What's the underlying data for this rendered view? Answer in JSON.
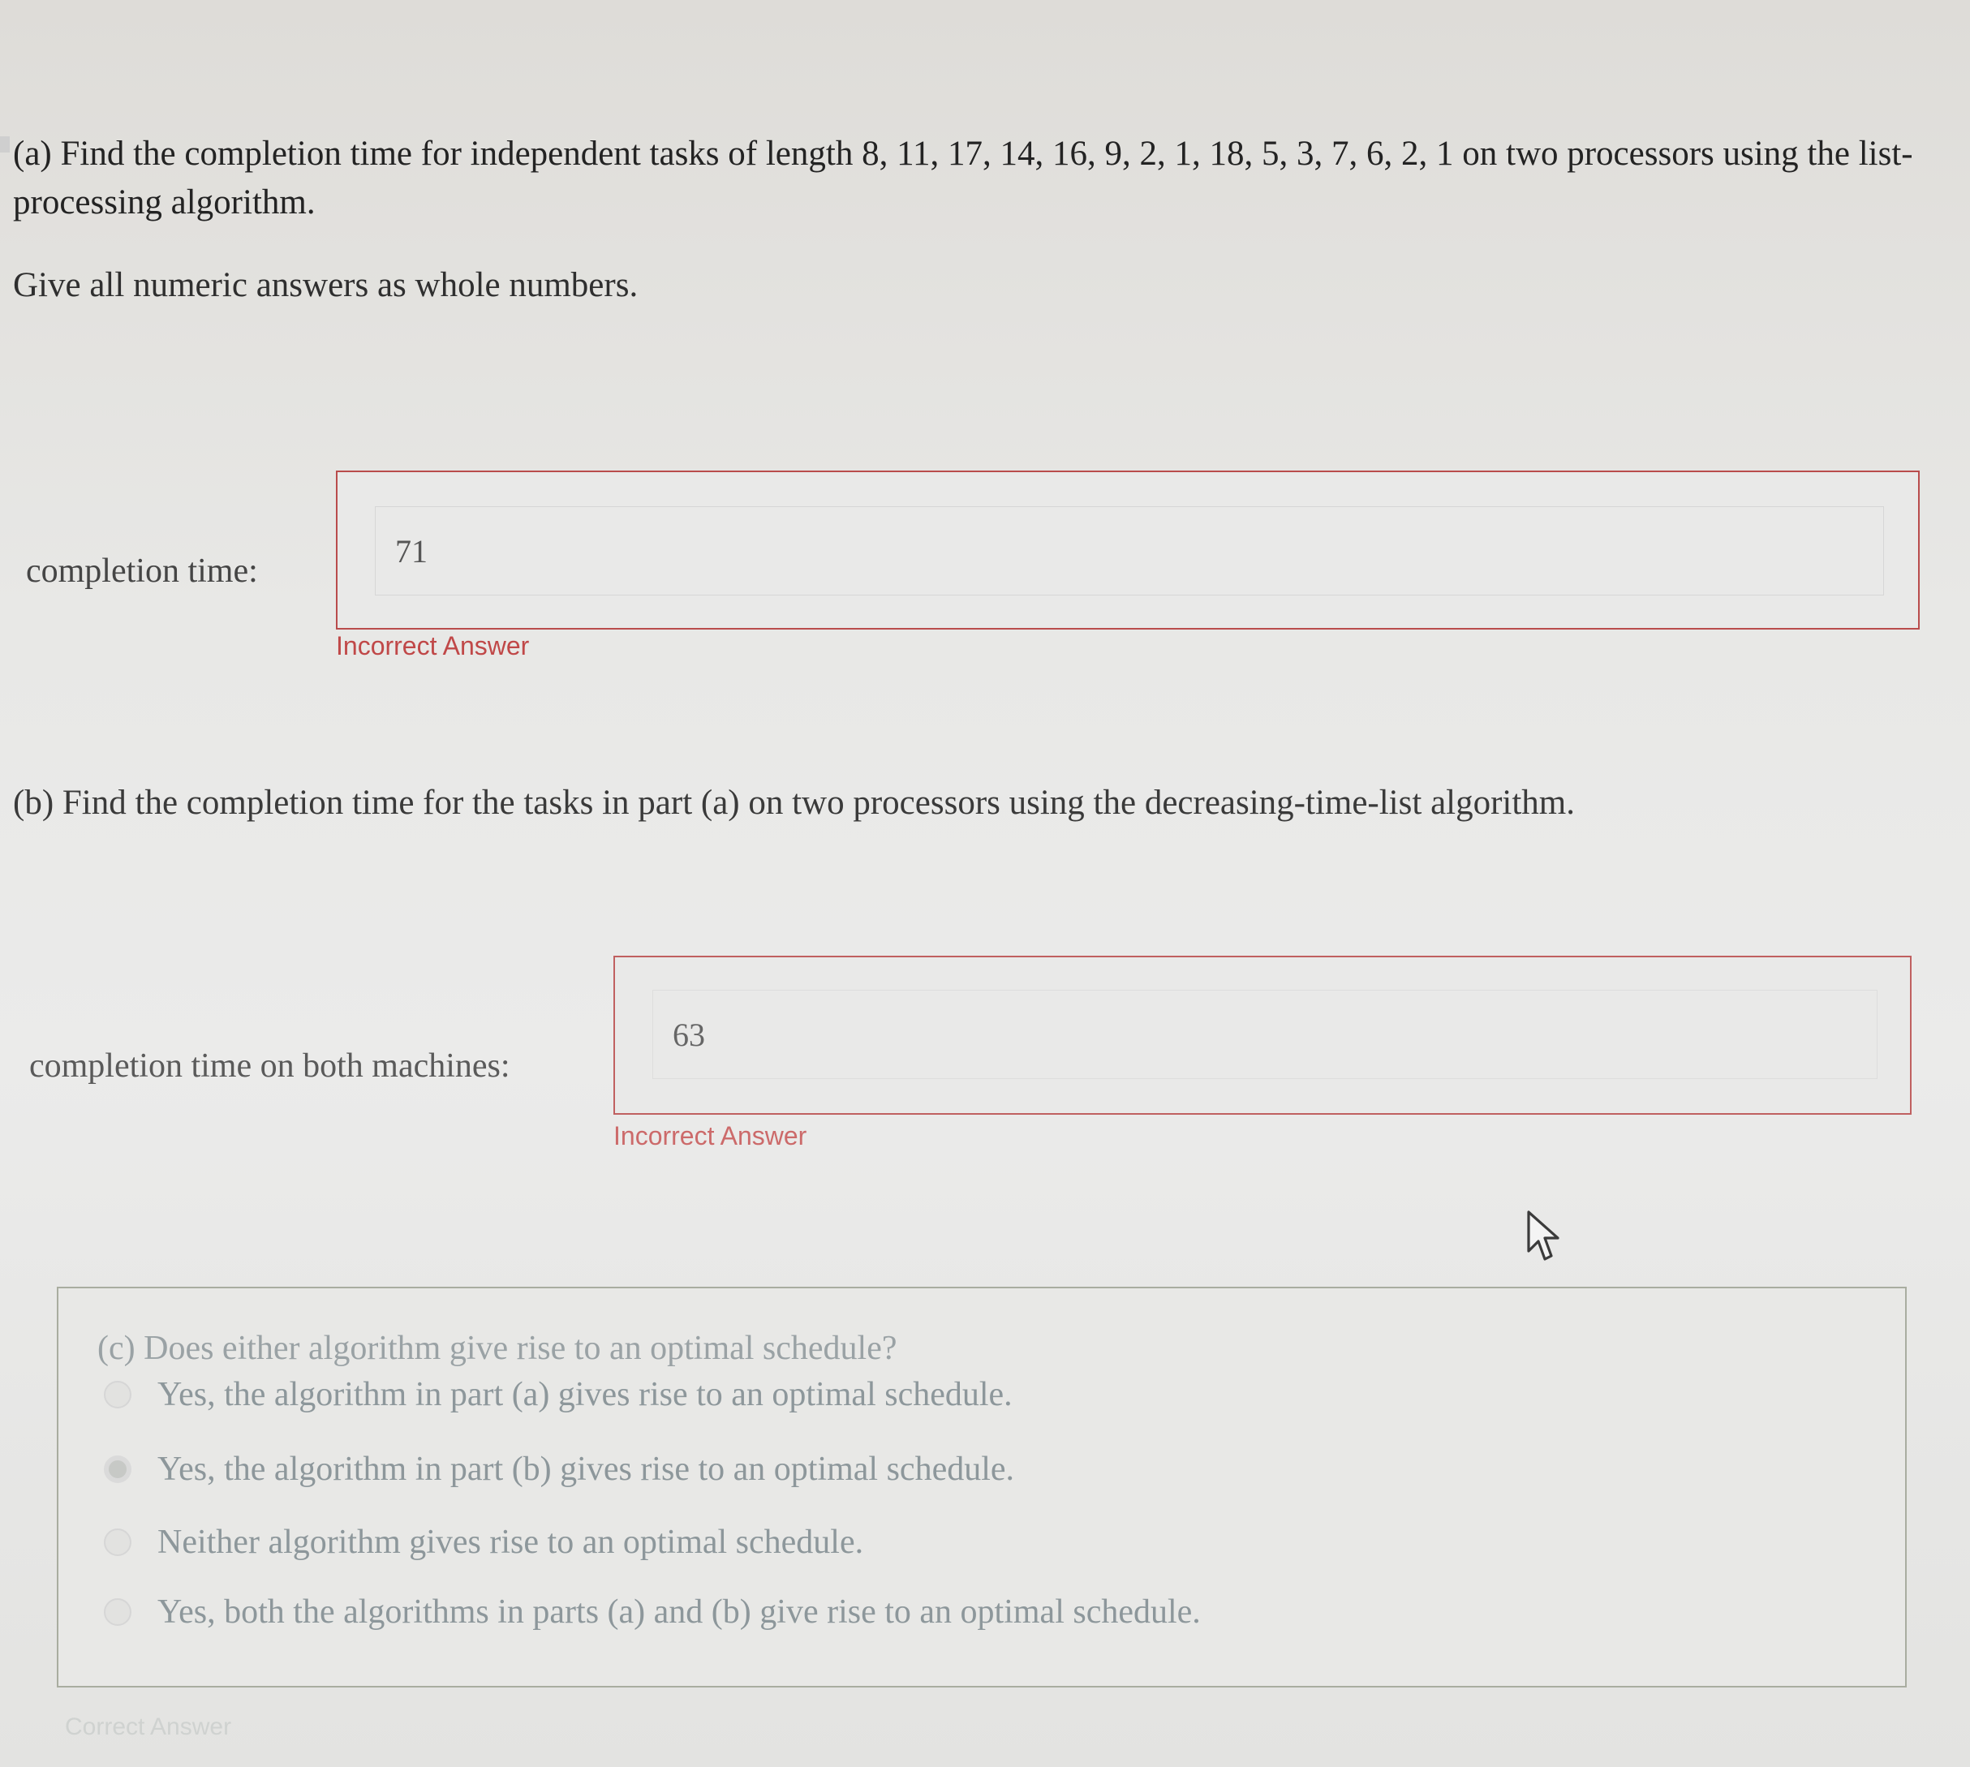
{
  "part_a": {
    "question": "(a) Find the completion time for independent tasks of length 8, 11, 17, 14, 16, 9, 2, 1, 18, 5, 3, 7, 6, 2, 1 on two processors using the list-processing algorithm.",
    "instruction": "Give all numeric answers as whole numbers.",
    "label": "completion time:",
    "answer_value": "71",
    "feedback": "Incorrect Answer"
  },
  "part_b": {
    "question": "(b) Find the completion time for the tasks in part (a) on two processors using the decreasing-time-list algorithm.",
    "label": "completion time on both machines:",
    "answer_value": "63",
    "feedback": "Incorrect Answer"
  },
  "part_c": {
    "question": "(c) Does either algorithm give rise to an optimal schedule?",
    "options": [
      "Yes, the algorithm in part (a) gives rise to an optimal schedule.",
      "Yes, the algorithm in part (b) gives rise to an optimal schedule.",
      "Neither algorithm gives rise to an optimal schedule.",
      "Yes, both the algorithms in parts (a) and (b) give rise to an optimal schedule."
    ],
    "selected_index": 1,
    "feedback": "Correct Answer"
  },
  "colors": {
    "incorrect": "#c04848",
    "box_border": "#b94c4c",
    "muted_text": "#8d979b"
  },
  "icons": {
    "cursor": "mouse-pointer-icon"
  }
}
